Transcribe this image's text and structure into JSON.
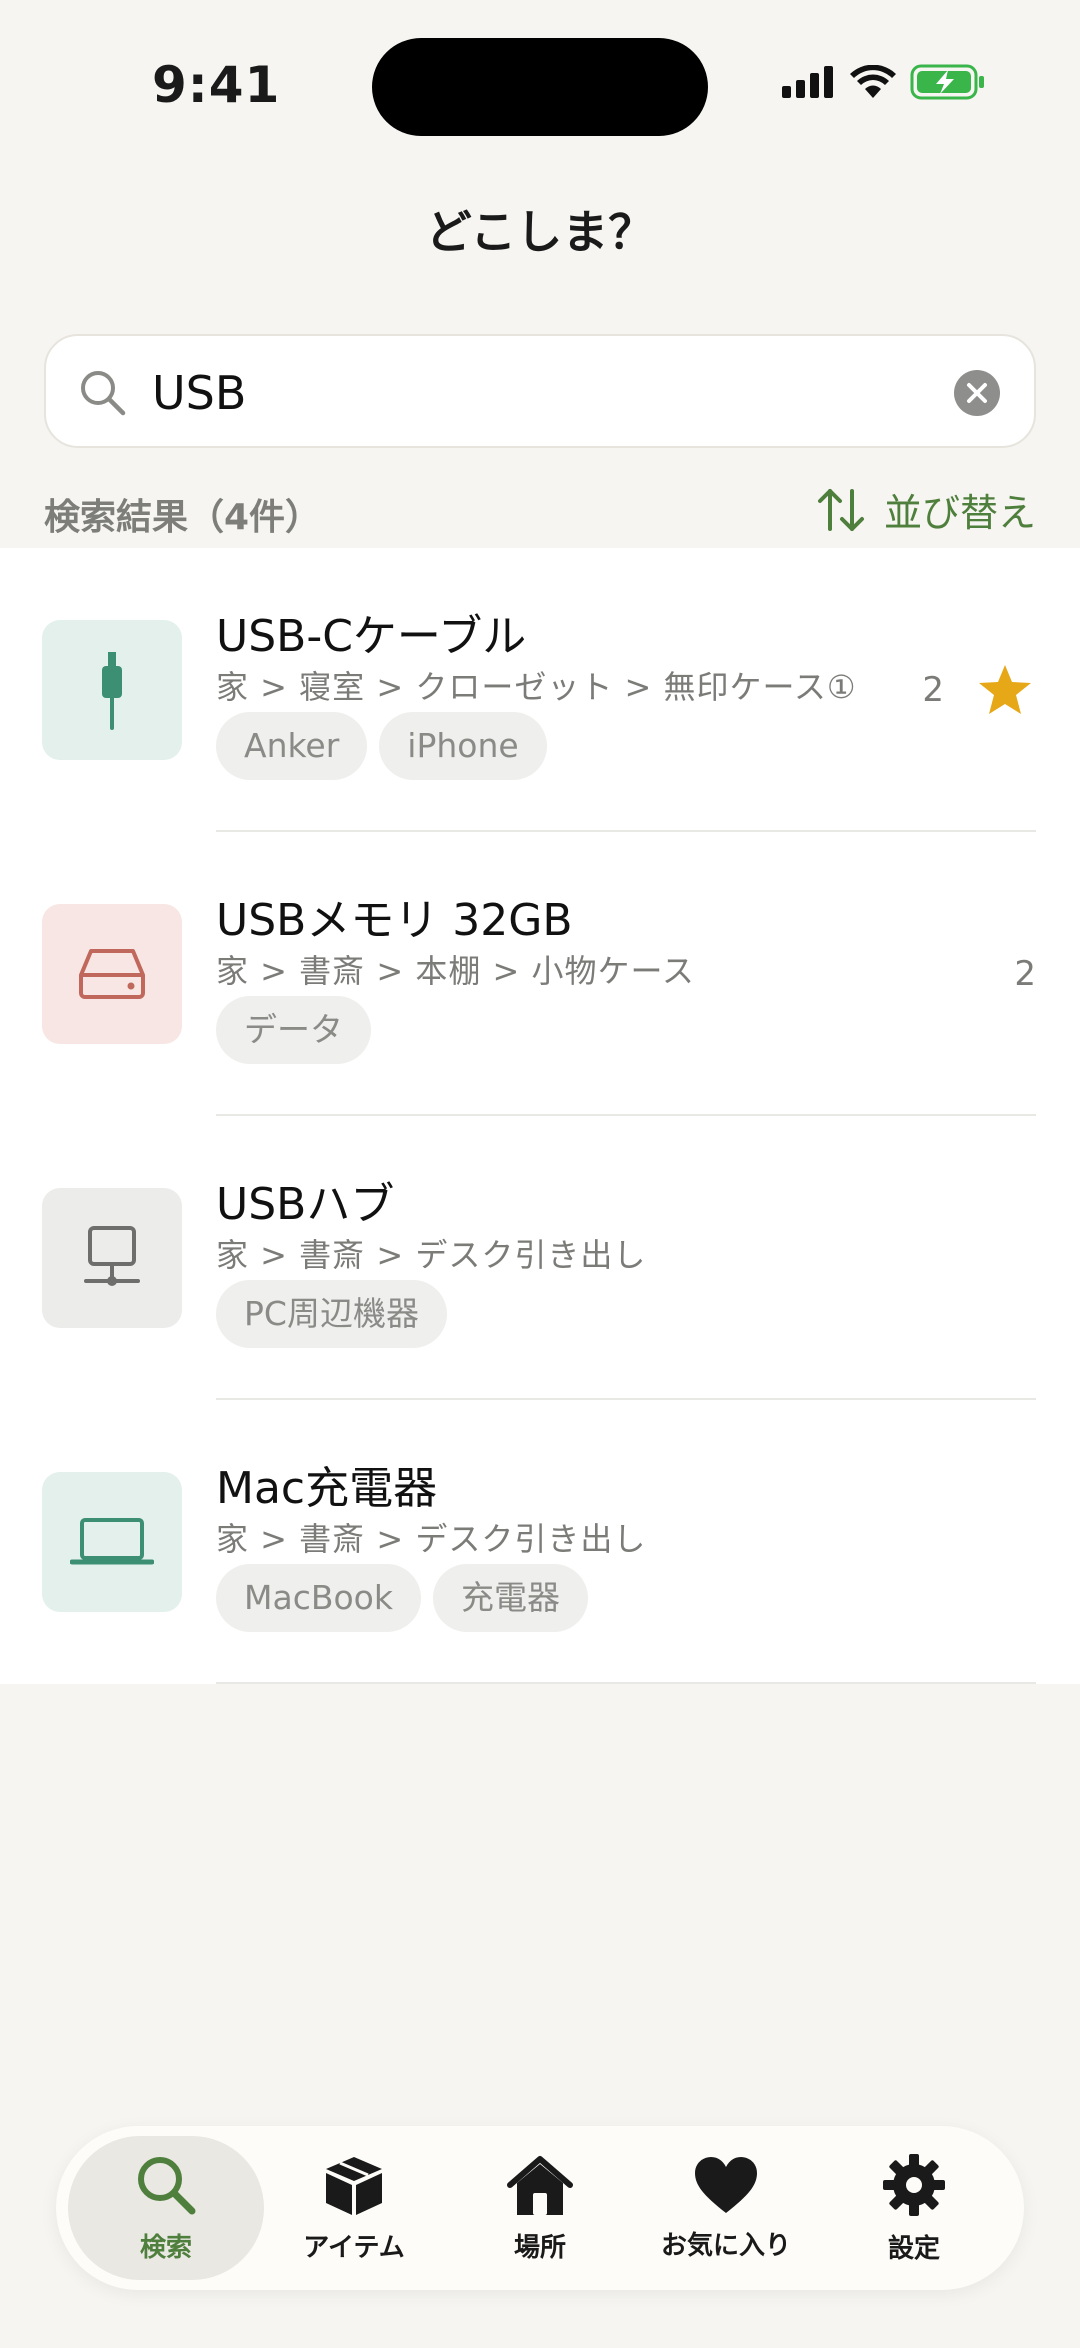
{
  "status_bar": {
    "time": "9:41"
  },
  "header": {
    "title": "どこしま？"
  },
  "search": {
    "query": "USB"
  },
  "results": {
    "count_label": "検索結果（4件）",
    "sort_label": "並び替え"
  },
  "items": [
    {
      "title": "USB-Cケーブル",
      "path": "家 > 寝室 > クローゼット > 無印ケース①",
      "tags": [
        "Anker",
        "iPhone"
      ],
      "count": "2",
      "favorite": true,
      "icon": "cable-icon",
      "thumb_color": "#e3f0ec",
      "icon_color": "#3c8f72"
    },
    {
      "title": "USBメモリ 32GB",
      "path": "家 > 書斎 > 本棚 > 小物ケース",
      "tags": [
        "データ"
      ],
      "count": "2",
      "favorite": false,
      "icon": "drive-icon",
      "thumb_color": "#f7e6e3",
      "icon_color": "#c0685c"
    },
    {
      "title": "USBハブ",
      "path": "家 > 書斎 > デスク引き出し",
      "tags": [
        "PC周辺機器"
      ],
      "count": "",
      "favorite": false,
      "icon": "network-icon",
      "thumb_color": "#ececea",
      "icon_color": "#6e6e6c"
    },
    {
      "title": "Mac充電器",
      "path": "家 > 書斎 > デスク引き出し",
      "tags": [
        "MacBook",
        "充電器"
      ],
      "count": "",
      "favorite": false,
      "icon": "laptop-icon",
      "thumb_color": "#e3f0ec",
      "icon_color": "#3c8f72"
    }
  ],
  "tabs": [
    {
      "label": "検索",
      "icon": "search-icon",
      "active": true
    },
    {
      "label": "アイテム",
      "icon": "box-icon",
      "active": false
    },
    {
      "label": "場所",
      "icon": "home-icon",
      "active": false
    },
    {
      "label": "お気に入り",
      "icon": "heart-icon",
      "active": false
    },
    {
      "label": "設定",
      "icon": "gear-icon",
      "active": false
    }
  ],
  "colors": {
    "accent": "#4f7f3c",
    "star": "#e6a817",
    "background": "#f6f5f1"
  }
}
